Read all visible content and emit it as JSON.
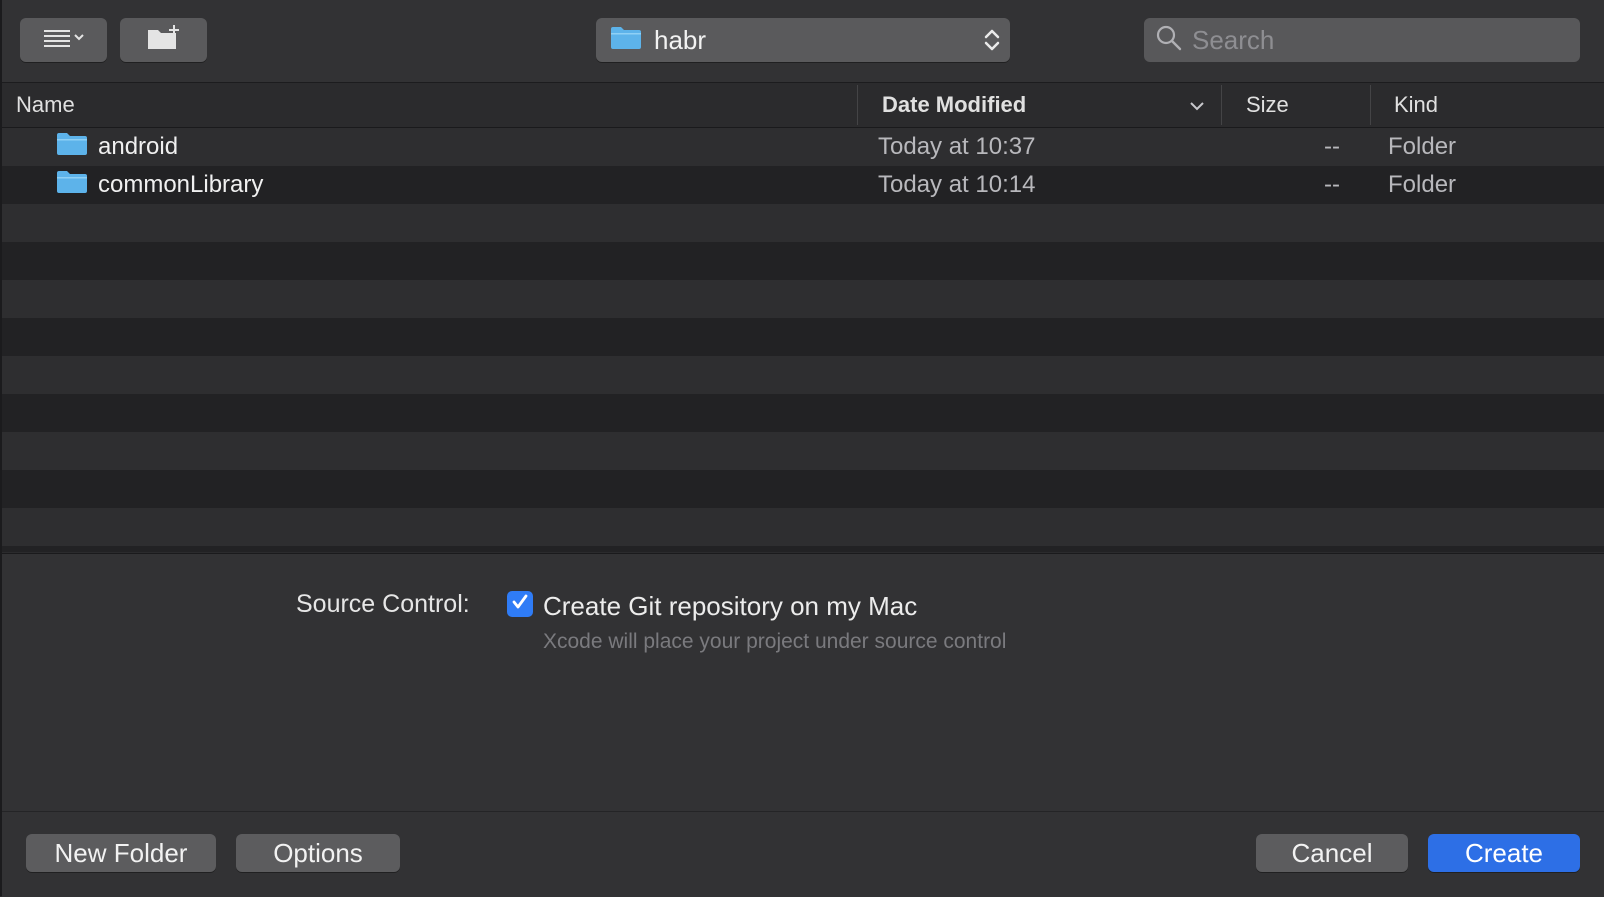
{
  "toolbar": {
    "location": "habr",
    "search_placeholder": "Search"
  },
  "columns": {
    "name": "Name",
    "date_modified": "Date Modified",
    "size": "Size",
    "kind": "Kind"
  },
  "files": [
    {
      "name": "android",
      "date": "Today at 10:37",
      "size": "--",
      "kind": "Folder"
    },
    {
      "name": "commonLibrary",
      "date": "Today at 10:14",
      "size": "--",
      "kind": "Folder"
    }
  ],
  "source_control": {
    "label": "Source Control:",
    "checkbox_label": "Create Git repository on my Mac",
    "checked": true,
    "hint": "Xcode will place your project under source control"
  },
  "buttons": {
    "new_folder": "New Folder",
    "options": "Options",
    "cancel": "Cancel",
    "create": "Create"
  },
  "colors": {
    "accent": "#2d6fe6",
    "folder": "#5db3ea"
  },
  "icons": {
    "view": "list-view-icon",
    "new_folder": "new-folder-icon",
    "location": "folder-icon",
    "stepper": "updown-chevron-icon",
    "search": "search-icon",
    "sort": "chevron-down-icon",
    "check": "checkmark-icon"
  }
}
